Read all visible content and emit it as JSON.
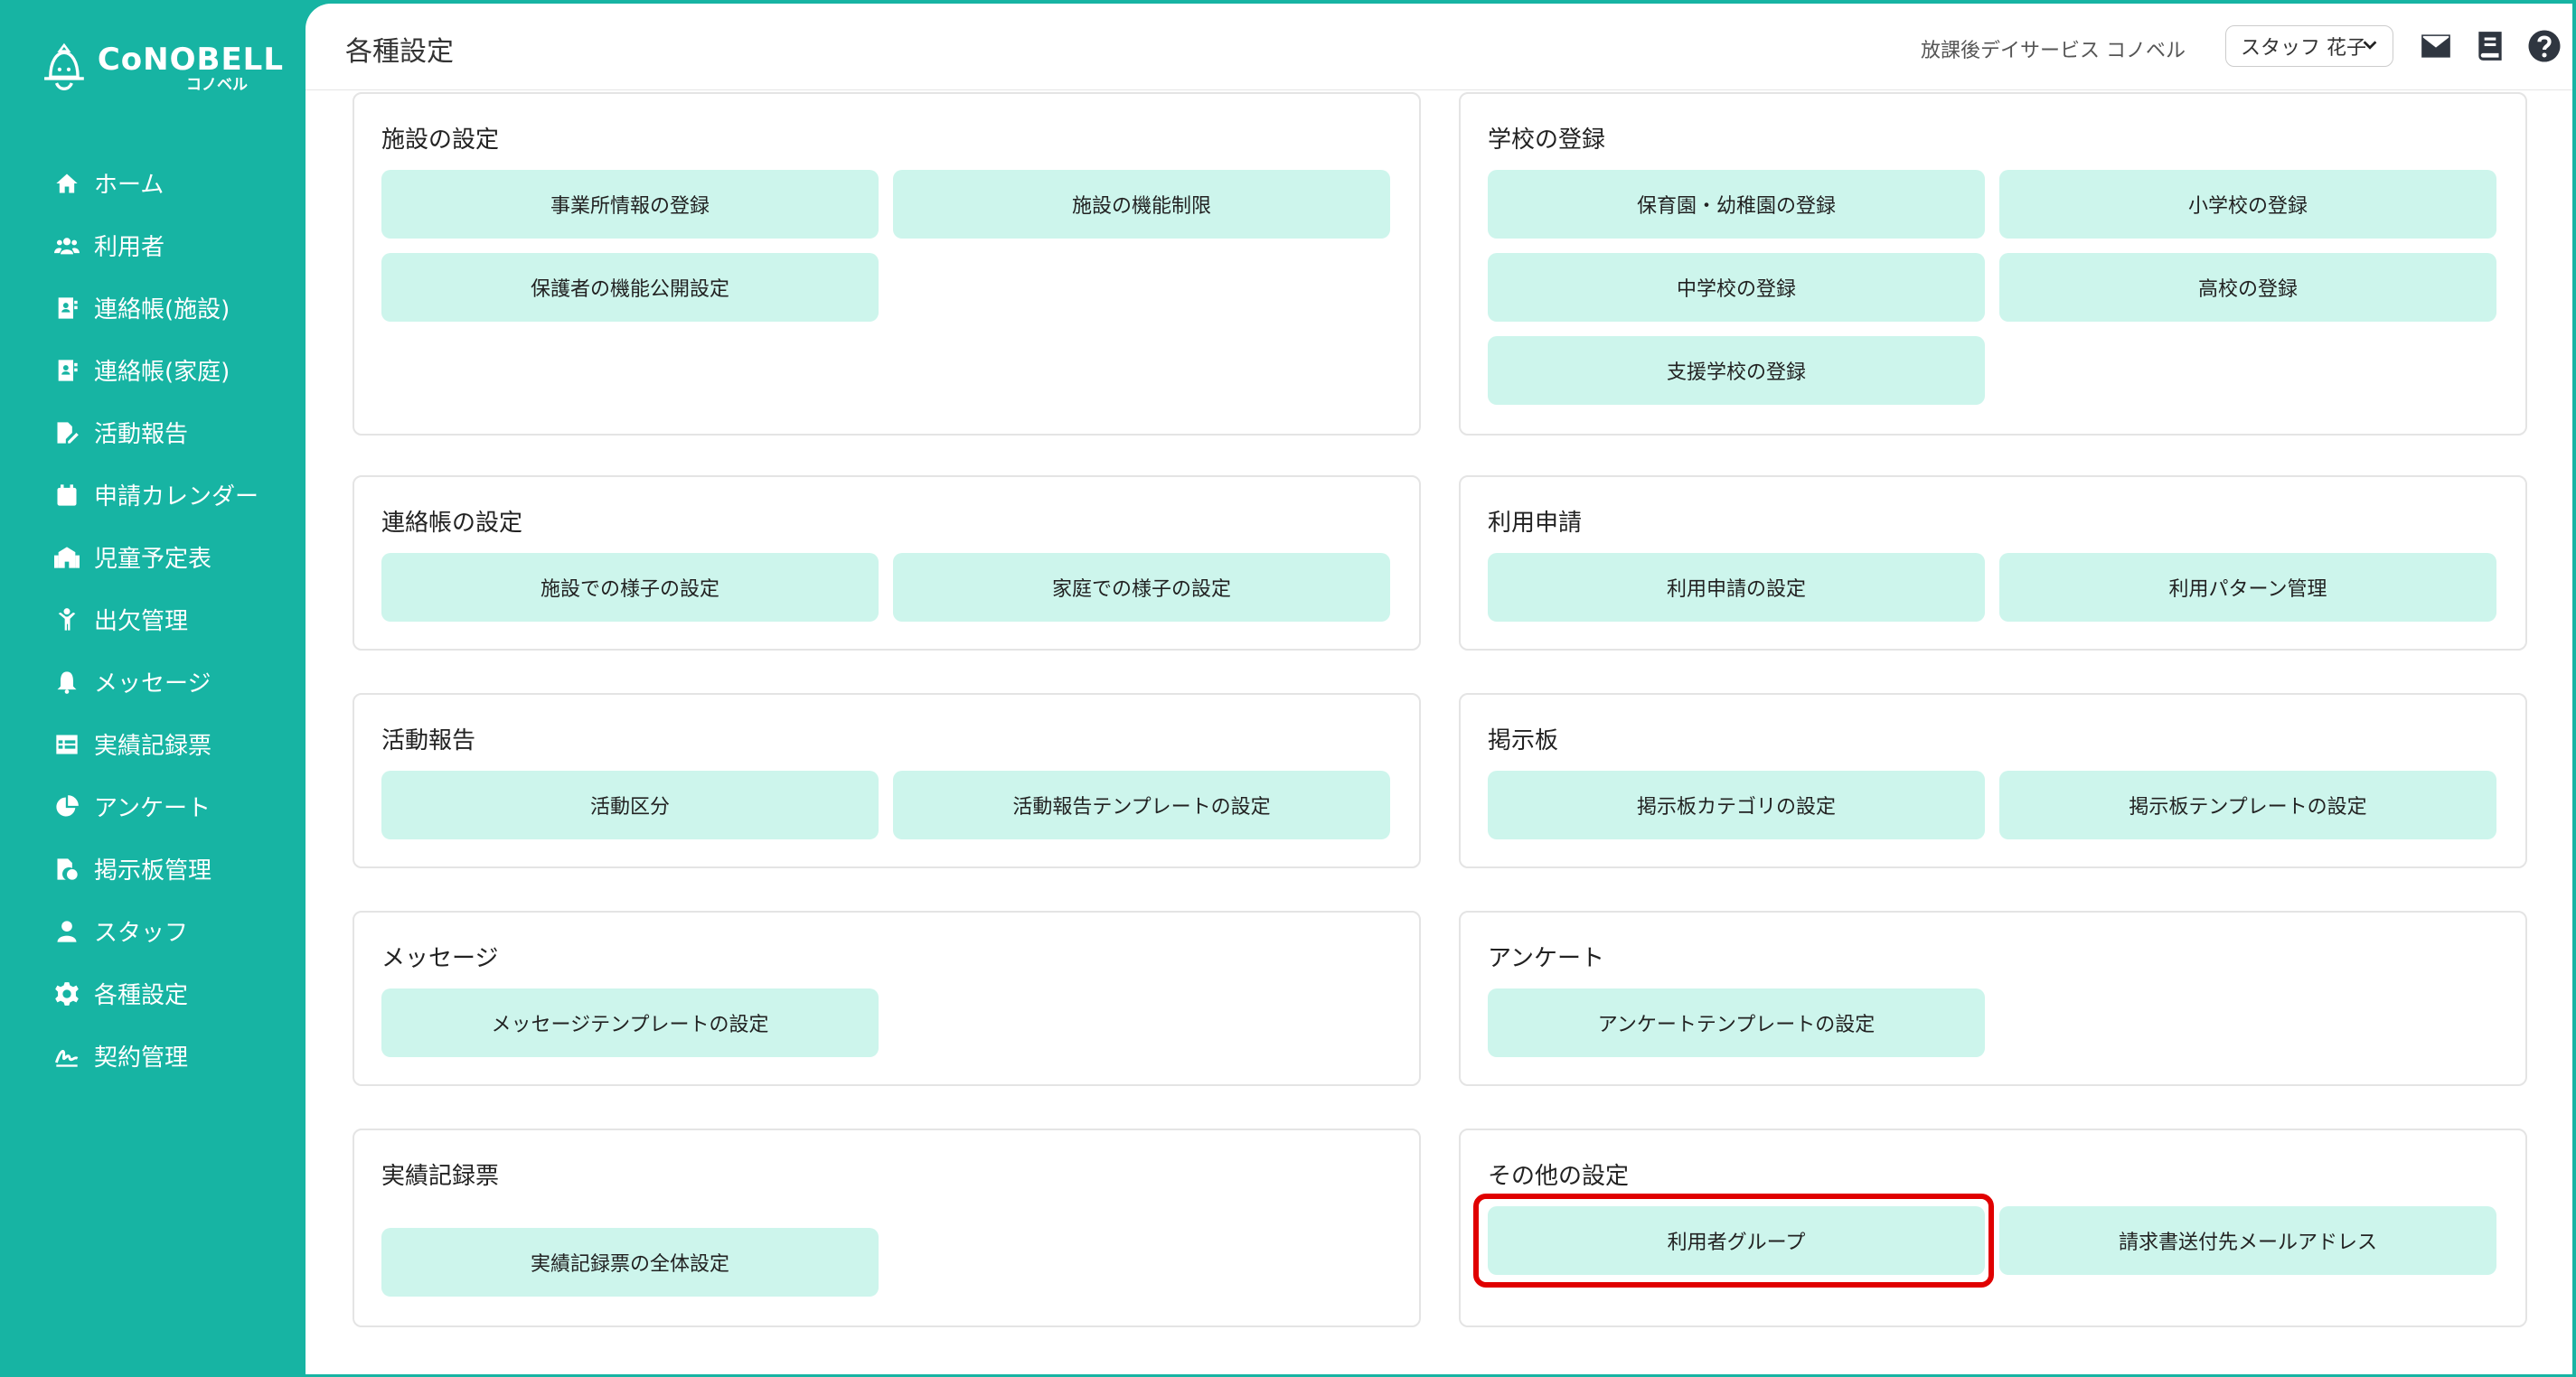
{
  "app": {
    "logo_text": "CoNOBELL",
    "logo_sub": "コノベル"
  },
  "sidebar": {
    "items": [
      {
        "label": "ホーム",
        "icon": "home-icon"
      },
      {
        "label": "利用者",
        "icon": "users-icon"
      },
      {
        "label": "連絡帳(施設)",
        "icon": "contact-book-icon"
      },
      {
        "label": "連絡帳(家庭)",
        "icon": "contact-book-icon"
      },
      {
        "label": "活動報告",
        "icon": "report-edit-icon"
      },
      {
        "label": "申請カレンダー",
        "icon": "calendar-icon"
      },
      {
        "label": "児童予定表",
        "icon": "school-building-icon"
      },
      {
        "label": "出欠管理",
        "icon": "person-icon"
      },
      {
        "label": "メッセージ",
        "icon": "bell-icon"
      },
      {
        "label": "実績記録票",
        "icon": "table-icon"
      },
      {
        "label": "アンケート",
        "icon": "pie-chart-icon"
      },
      {
        "label": "掲示板管理",
        "icon": "file-check-icon"
      },
      {
        "label": "スタッフ",
        "icon": "user-icon"
      },
      {
        "label": "各種設定",
        "icon": "gear-icon"
      },
      {
        "label": "契約管理",
        "icon": "signature-icon"
      }
    ]
  },
  "header": {
    "title": "各種設定",
    "facility_name": "放課後デイサービス コノベル",
    "staff_selected": "スタッフ 花子"
  },
  "cards": {
    "facility": {
      "title": "施設の設定",
      "buttons": [
        "事業所情報の登録",
        "施設の機能制限",
        "保護者の機能公開設定"
      ]
    },
    "school": {
      "title": "学校の登録",
      "buttons": [
        "保育園・幼稚園の登録",
        "小学校の登録",
        "中学校の登録",
        "高校の登録",
        "支援学校の登録"
      ]
    },
    "contact": {
      "title": "連絡帳の設定",
      "buttons": [
        "施設での様子の設定",
        "家庭での様子の設定"
      ]
    },
    "usage": {
      "title": "利用申請",
      "buttons": [
        "利用申請の設定",
        "利用パターン管理"
      ]
    },
    "activity": {
      "title": "活動報告",
      "buttons": [
        "活動区分",
        "活動報告テンプレートの設定"
      ]
    },
    "board": {
      "title": "掲示板",
      "buttons": [
        "掲示板カテゴリの設定",
        "掲示板テンプレートの設定"
      ]
    },
    "message": {
      "title": "メッセージ",
      "buttons": [
        "メッセージテンプレートの設定"
      ]
    },
    "survey": {
      "title": "アンケート",
      "buttons": [
        "アンケートテンプレートの設定"
      ]
    },
    "record": {
      "title": "実績記録票",
      "buttons": [
        "実績記録票の全体設定"
      ]
    },
    "other": {
      "title": "その他の設定",
      "buttons": [
        "利用者グループ",
        "請求書送付先メールアドレス"
      ]
    }
  },
  "colors": {
    "brand": "#17b4a3",
    "button_bg": "#cdf5ec",
    "highlight": "#e00000"
  }
}
